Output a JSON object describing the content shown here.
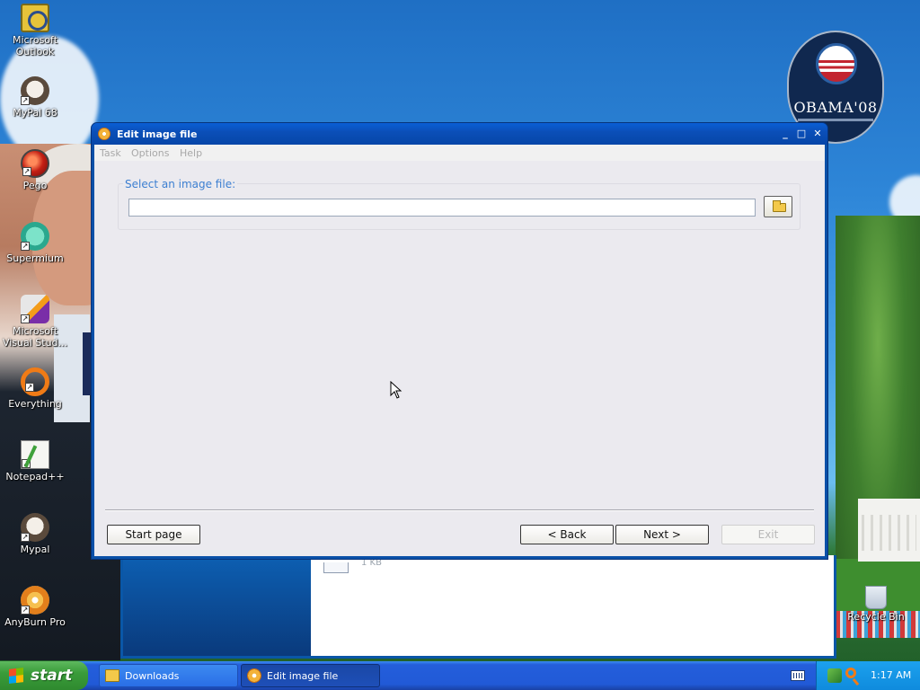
{
  "desktop": {
    "icons": [
      {
        "label": "Microsoft Outlook",
        "icon": "outlook-icon"
      },
      {
        "label": "MyPal 68",
        "icon": "mypal-icon"
      },
      {
        "label": "Pego",
        "icon": "pego-icon"
      },
      {
        "label": "Supermium",
        "icon": "supermium-icon"
      },
      {
        "label": "Microsoft Visual Stud...",
        "icon": "visual-studio-icon"
      },
      {
        "label": "Everything",
        "icon": "everything-icon"
      },
      {
        "label": "Notepad++",
        "icon": "notepad-plus-plus-icon"
      },
      {
        "label": "Mypal",
        "icon": "mypal-icon"
      },
      {
        "label": "AnyBurn Pro",
        "icon": "anyburn-icon"
      },
      {
        "label": "Recycle Bin",
        "icon": "recycle-bin-icon"
      }
    ],
    "logo_text": "OBAMA'08",
    "background_window_size_text": "1 KB"
  },
  "dialog": {
    "title": "Edit image file",
    "menu": [
      "Task",
      "Options",
      "Help"
    ],
    "group_label": "Select an image file:",
    "file_input_value": "",
    "buttons": {
      "start_page": "Start page",
      "back": "< Back",
      "next": "Next >",
      "exit": "Exit"
    }
  },
  "taskbar": {
    "start_label": "start",
    "tasks": [
      {
        "label": "Downloads",
        "active": false
      },
      {
        "label": "Edit image file",
        "active": true
      }
    ],
    "clock": "1:17 AM"
  },
  "colors": {
    "titlebar": "#0a5fd6",
    "group_title": "#3c7fd1",
    "start_button": "#3a9c3a",
    "taskbar": "#245edb"
  }
}
